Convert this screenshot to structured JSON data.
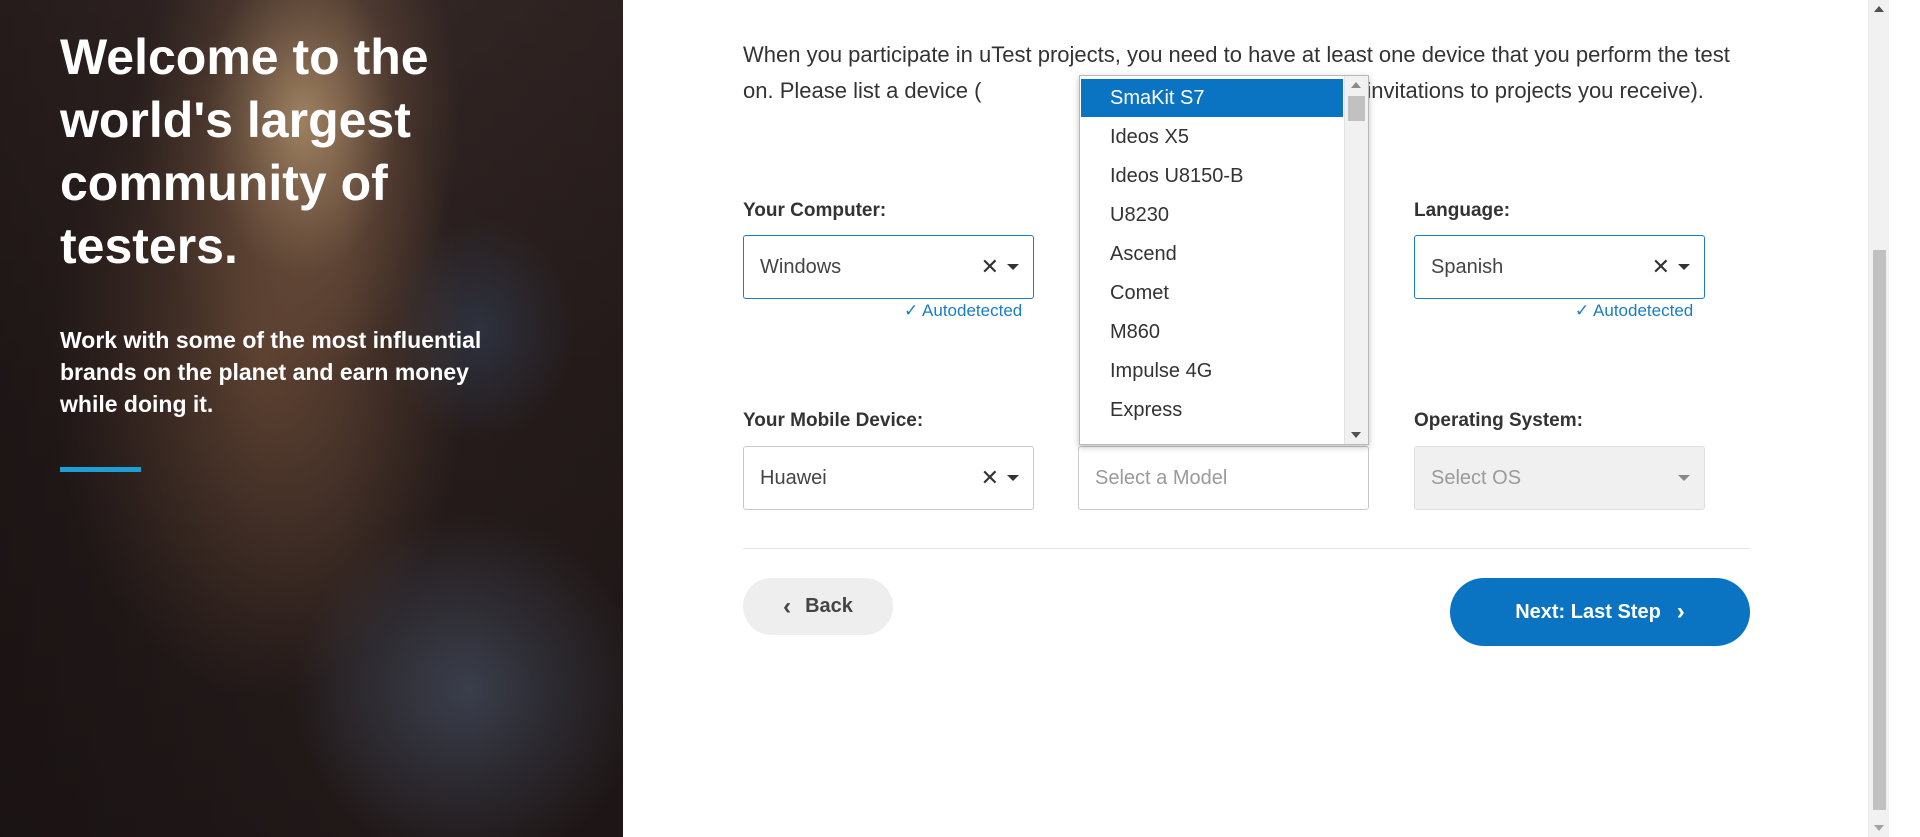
{
  "hero": {
    "title": "Welcome to the world's largest community of testers.",
    "subtitle": "Work with some of the most influential brands on the planet and earn money while doing it.",
    "accent_color": "#1e9ed4"
  },
  "intro": {
    "prefix": "When you participate in uTest projects, you need to have at least one device that you perform the test on. Please list a device (",
    "suffix": "the more invitations to projects you receive)."
  },
  "computer": {
    "label": "Your Computer:",
    "value": "Windows",
    "clear_icon": "close-icon",
    "autodetect": "Autodetected"
  },
  "language": {
    "label": "Language:",
    "value": "Spanish",
    "clear_icon": "close-icon",
    "autodetect": "Autodetected"
  },
  "mobile": {
    "label": "Your Mobile Device:",
    "value": "Huawei",
    "clear_icon": "close-icon"
  },
  "model": {
    "placeholder": "Select a Model"
  },
  "os": {
    "label": "Operating System:",
    "placeholder": "Select OS"
  },
  "dropdown": {
    "options": [
      {
        "label": "SmaKit S7",
        "selected": true
      },
      {
        "label": "Ideos X5",
        "selected": false
      },
      {
        "label": "Ideos U8150-B",
        "selected": false
      },
      {
        "label": "U8230",
        "selected": false
      },
      {
        "label": "Ascend",
        "selected": false
      },
      {
        "label": "Comet",
        "selected": false
      },
      {
        "label": "M860",
        "selected": false
      },
      {
        "label": "Impulse 4G",
        "selected": false
      },
      {
        "label": "Express",
        "selected": false
      }
    ]
  },
  "buttons": {
    "back": "Back",
    "next": "Next: Last Step"
  },
  "colors": {
    "primary": "#0a74c2",
    "link": "#1a7dc4",
    "back_bg": "#eeeeee"
  }
}
